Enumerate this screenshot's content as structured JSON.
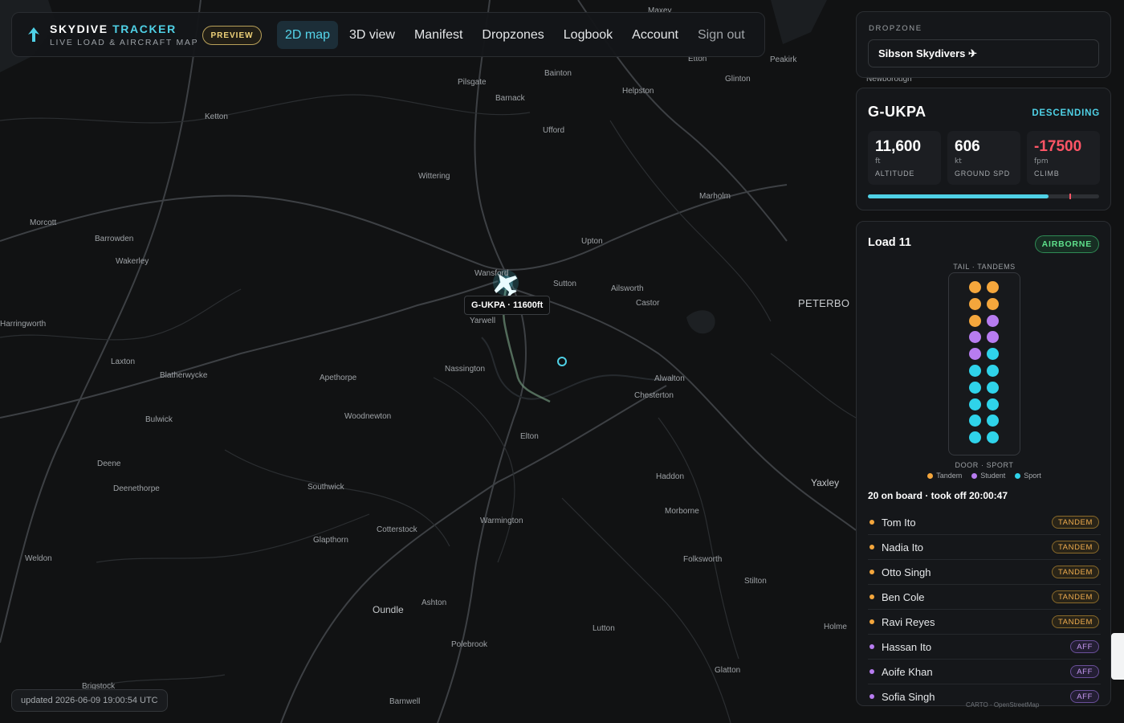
{
  "app": {
    "brand_main": "SKYDIVE ",
    "brand_accent": "TRACKER",
    "brand_sub": "LIVE LOAD & AIRCRAFT MAP",
    "preview_badge": "PREVIEW"
  },
  "nav": [
    {
      "label": "2D map",
      "active": true
    },
    {
      "label": "3D view"
    },
    {
      "label": "Manifest"
    },
    {
      "label": "Dropzones"
    },
    {
      "label": "Logbook"
    },
    {
      "label": "Account"
    },
    {
      "label": "Sign out",
      "muted": true
    }
  ],
  "dropzone": {
    "label": "DROPZONE",
    "selected": "Sibson Skydivers ✈"
  },
  "aircraft": {
    "registration": "G-UKPA",
    "status": "DESCENDING",
    "altitude": {
      "value": "11,600",
      "unit": "ft",
      "label": "ALTITUDE"
    },
    "ground_speed": {
      "value": "606",
      "unit": "kt",
      "label": "GROUND SPD"
    },
    "climb": {
      "value": "-17500",
      "unit": "fpm",
      "label": "CLIMB"
    },
    "altitude_fraction": 0.78,
    "jump_altitude_fraction": 0.87,
    "map_tag": "G-UKPA · 11600ft"
  },
  "load": {
    "title": "Load 11",
    "status": "AIRBORNE",
    "tail_label": "TAIL · TANDEMS",
    "door_label": "DOOR · SPORT",
    "legend": [
      {
        "label": "Tandem",
        "type": "tandem"
      },
      {
        "label": "Student",
        "type": "student"
      },
      {
        "label": "Sport",
        "type": "sport"
      }
    ],
    "seats": [
      "tandem",
      "tandem",
      "tandem",
      "tandem",
      "tandem",
      "student",
      "student",
      "student",
      "student",
      "sport",
      "sport",
      "sport",
      "sport",
      "sport",
      "sport",
      "sport",
      "sport",
      "sport",
      "sport",
      "sport"
    ],
    "summary": "20 on board · took off 20:00:47",
    "jumpers": [
      {
        "name": "Tom Ito",
        "type": "tandem",
        "badge": "TANDEM"
      },
      {
        "name": "Nadia Ito",
        "type": "tandem",
        "badge": "TANDEM"
      },
      {
        "name": "Otto Singh",
        "type": "tandem",
        "badge": "TANDEM"
      },
      {
        "name": "Ben Cole",
        "type": "tandem",
        "badge": "TANDEM"
      },
      {
        "name": "Ravi Reyes",
        "type": "tandem",
        "badge": "TANDEM"
      },
      {
        "name": "Hassan Ito",
        "type": "student",
        "badge": "AFF"
      },
      {
        "name": "Aoife Khan",
        "type": "student",
        "badge": "AFF"
      },
      {
        "name": "Sofia Singh",
        "type": "student",
        "badge": "AFF"
      }
    ]
  },
  "colors": {
    "tandem": "#f4a63c",
    "student": "#b77cf0",
    "sport": "#2fd3ea",
    "accent": "#4fd1e6",
    "danger": "#ff5566",
    "ok": "#5ee08b"
  },
  "updated": "updated 2026-06-09 19:00:54 UTC",
  "attribution": "CARTO · OpenStreetMap",
  "places": [
    {
      "name": "Pilsgate"
    },
    {
      "name": "Bainton"
    },
    {
      "name": "Helpston"
    },
    {
      "name": "Glinton"
    },
    {
      "name": "Barnack"
    },
    {
      "name": "Ufford"
    },
    {
      "name": "Ketton"
    },
    {
      "name": "Wittering"
    },
    {
      "name": "Marholm"
    },
    {
      "name": "Morcott"
    },
    {
      "name": "Barrowden"
    },
    {
      "name": "Wakerley"
    },
    {
      "name": "Upton"
    },
    {
      "name": "Wansford"
    },
    {
      "name": "Sutton"
    },
    {
      "name": "Ailsworth"
    },
    {
      "name": "Castor"
    },
    {
      "name": "Yarwell"
    },
    {
      "name": "Laxton"
    },
    {
      "name": "Blatherwycke"
    },
    {
      "name": "Apethorpe"
    },
    {
      "name": "Nassington"
    },
    {
      "name": "Alwalton"
    },
    {
      "name": "Chesterton"
    },
    {
      "name": "Bulwick"
    },
    {
      "name": "Woodnewton"
    },
    {
      "name": "Elton"
    },
    {
      "name": "Deene"
    },
    {
      "name": "Deenethorpe"
    },
    {
      "name": "Southwick"
    },
    {
      "name": "Haddon"
    },
    {
      "name": "Morborne"
    },
    {
      "name": "Cotterstock"
    },
    {
      "name": "Warmington"
    },
    {
      "name": "Glapthorn"
    },
    {
      "name": "Weldon"
    },
    {
      "name": "Folksworth"
    },
    {
      "name": "Stilton"
    },
    {
      "name": "Ashton"
    },
    {
      "name": "Oundle"
    },
    {
      "name": "Polebrook"
    },
    {
      "name": "Lutton"
    },
    {
      "name": "Holme"
    },
    {
      "name": "Glatton"
    },
    {
      "name": "Barnwell"
    },
    {
      "name": "Brigstock"
    },
    {
      "name": "Etton"
    },
    {
      "name": "Peakirk"
    },
    {
      "name": "Maxey"
    },
    {
      "name": "Newborough"
    },
    {
      "name": "Yaxley"
    },
    {
      "name": "PETERBO"
    },
    {
      "name": "Harringworth"
    }
  ]
}
